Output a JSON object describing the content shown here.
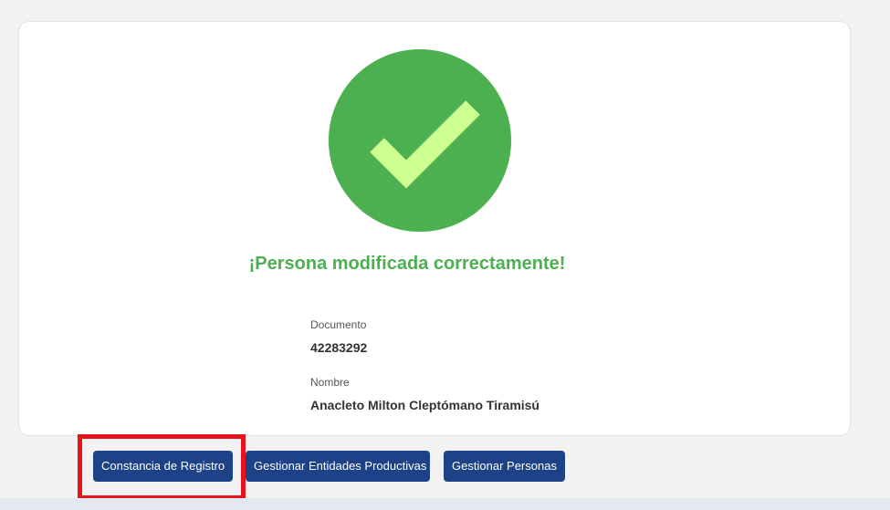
{
  "result": {
    "title": "¡Persona modificada correctamente!",
    "status_color": "#4caf50",
    "check_color": "#ccff90"
  },
  "fields": {
    "documento": {
      "label": "Documento",
      "value": "42283292"
    },
    "nombre": {
      "label": "Nombre",
      "value": "Anacleto Milton Cleptómano Tiramisú"
    }
  },
  "actions": {
    "constancia_label": "Constancia de Registro",
    "entidades_label": "Gestionar Entidades Productivas",
    "personas_label": "Gestionar Personas"
  },
  "colors": {
    "button_bg": "#1d4288",
    "highlight_border": "#e3141c"
  }
}
